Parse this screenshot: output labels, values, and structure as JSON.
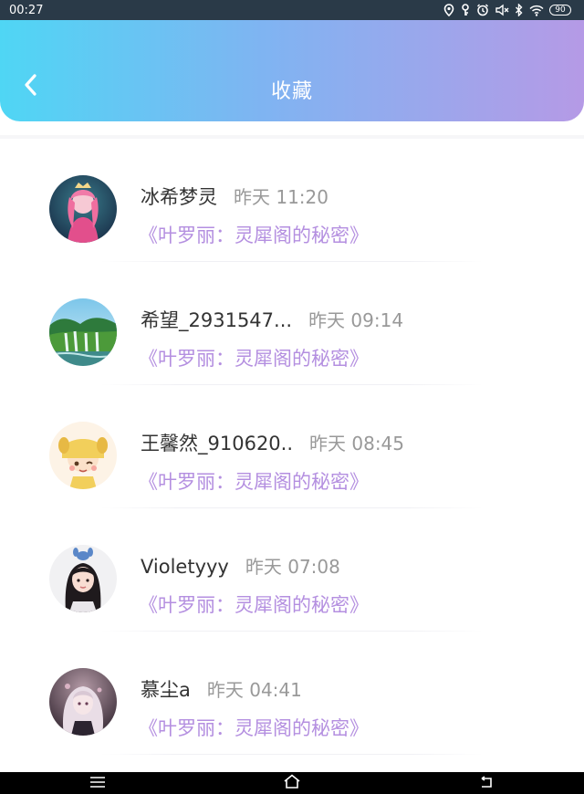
{
  "status_bar": {
    "time": "00:27",
    "battery": "90",
    "icons": [
      "location-icon",
      "key-icon",
      "alarm-icon",
      "mute-icon",
      "bluetooth-icon",
      "wifi-icon",
      "battery-icon"
    ]
  },
  "header": {
    "title": "收藏",
    "back_icon": "chevron-left-icon"
  },
  "favorites": [
    {
      "username": "冰希梦灵",
      "time": "昨天 11:20",
      "book": "《叶罗丽：灵犀阁的秘密》"
    },
    {
      "username": "希望_2931547...",
      "time": "昨天 09:14",
      "book": "《叶罗丽：灵犀阁的秘密》"
    },
    {
      "username": "王馨然_910620..",
      "time": "昨天 08:45",
      "book": "《叶罗丽：灵犀阁的秘密》"
    },
    {
      "username": "Violetyyy",
      "time": "昨天 07:08",
      "book": "《叶罗丽：灵犀阁的秘密》"
    },
    {
      "username": "慕尘a",
      "time": "昨天 04:41",
      "book": "《叶罗丽：灵犀阁的秘密》"
    }
  ],
  "nav_bar": {
    "icons": [
      "menu-icon",
      "home-icon",
      "back-icon"
    ]
  },
  "colors": {
    "header_gradient_start": "#4fd6f4",
    "header_gradient_end": "#b59ae6",
    "book_title": "#b48fe0",
    "time_text": "#999999"
  }
}
